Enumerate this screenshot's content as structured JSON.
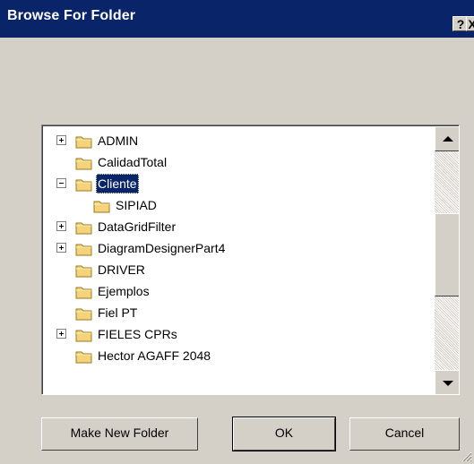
{
  "window": {
    "title": "Browse For Folder",
    "help_label": "?",
    "close_label": "X"
  },
  "tree": {
    "items": [
      {
        "label": "ADMIN",
        "expander": "plus",
        "level": 0,
        "selected": false
      },
      {
        "label": "CalidadTotal",
        "expander": "none",
        "level": 0,
        "selected": false
      },
      {
        "label": "Cliente",
        "expander": "minus",
        "level": 0,
        "selected": true
      },
      {
        "label": "SIPIAD",
        "expander": "none",
        "level": 1,
        "selected": false
      },
      {
        "label": "DataGridFilter",
        "expander": "plus",
        "level": 0,
        "selected": false
      },
      {
        "label": "DiagramDesignerPart4",
        "expander": "plus",
        "level": 0,
        "selected": false
      },
      {
        "label": "DRIVER",
        "expander": "none",
        "level": 0,
        "selected": false
      },
      {
        "label": "Ejemplos",
        "expander": "none",
        "level": 0,
        "selected": false
      },
      {
        "label": "Fiel PT",
        "expander": "none",
        "level": 0,
        "selected": false
      },
      {
        "label": "FIELES CPRs",
        "expander": "plus",
        "level": 0,
        "selected": false
      },
      {
        "label": "Hector AGAFF 2048",
        "expander": "none",
        "level": 0,
        "selected": false
      }
    ]
  },
  "scrollbar": {
    "position_fraction": 0.35,
    "visible_fraction": 0.4
  },
  "buttons": {
    "make_new_folder": "Make New Folder",
    "ok": "OK",
    "cancel": "Cancel"
  },
  "colors": {
    "title_bar": "#0a246a",
    "face": "#d4d0c8",
    "selection": "#0a246a",
    "folder": "#f5d37a"
  }
}
